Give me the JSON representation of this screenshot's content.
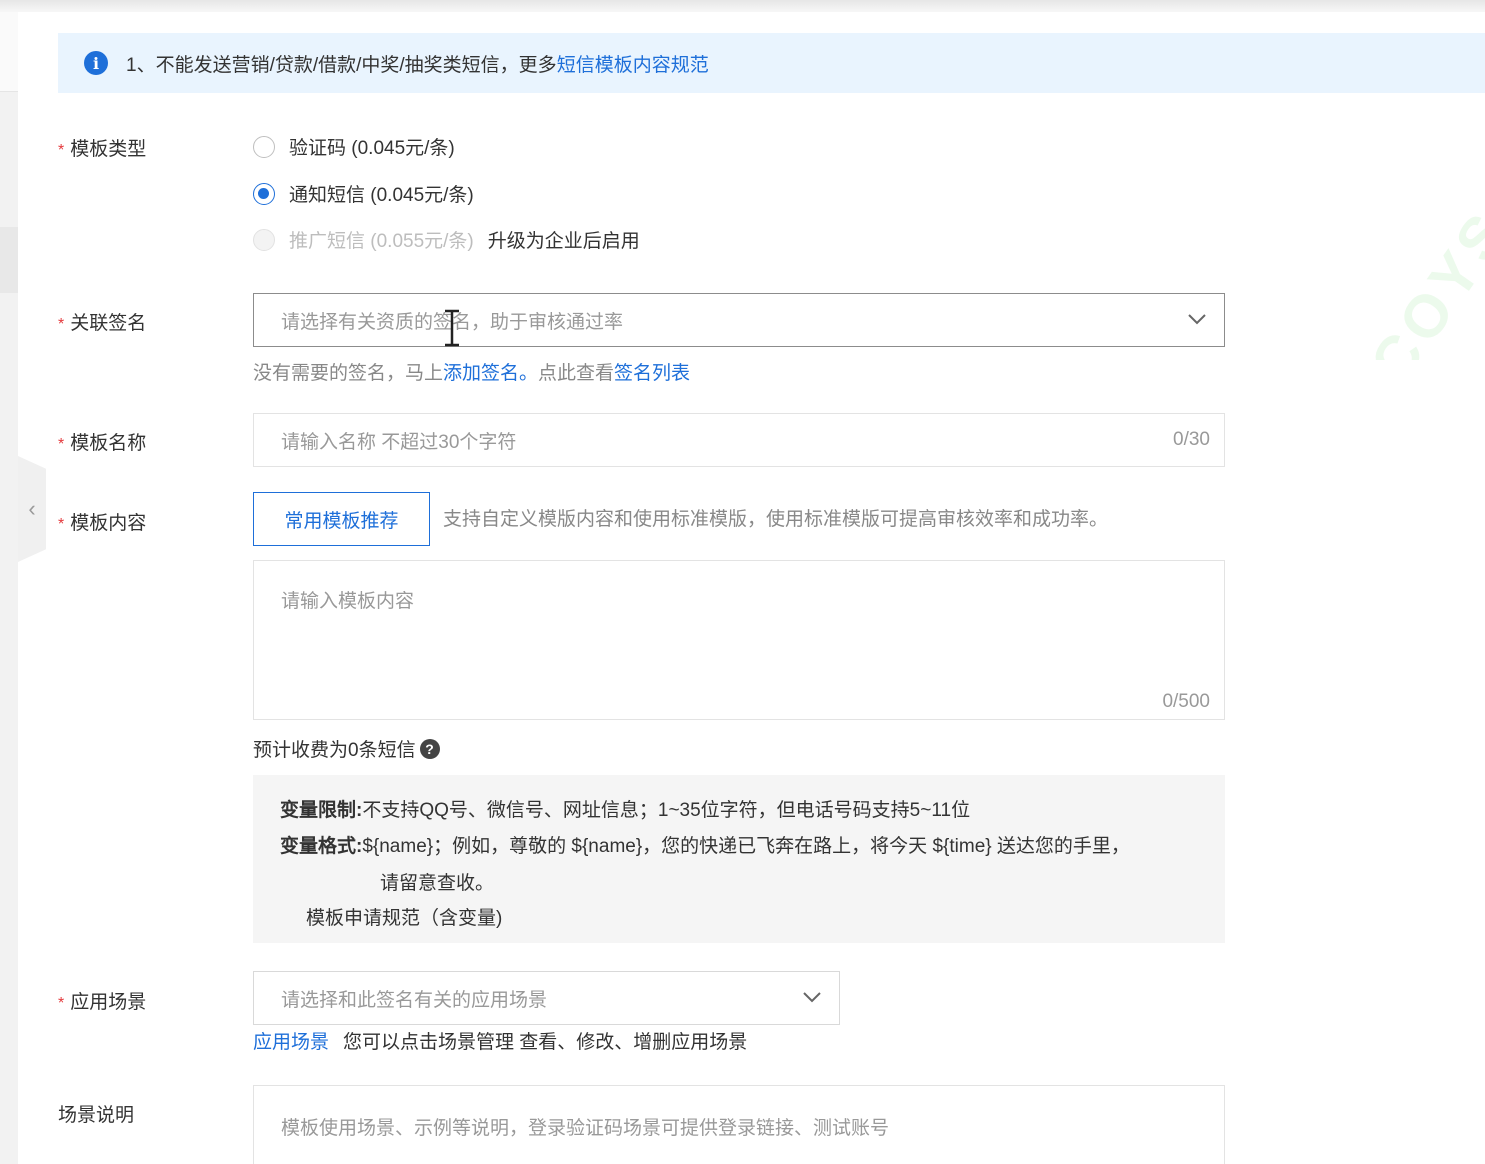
{
  "notice": {
    "icon": "info-icon",
    "text": "1、不能发送营销/贷款/借款/中奖/抽奖类短信，更多",
    "link": "短信模板内容规范"
  },
  "template_type": {
    "required_mark": "*",
    "label": "模板类型",
    "options": [
      {
        "label": "验证码 (0.045元/条)",
        "checked": false,
        "disabled": false
      },
      {
        "label": "通知短信 (0.045元/条)",
        "checked": true,
        "disabled": false
      },
      {
        "label": "推广短信 (0.055元/条)",
        "checked": false,
        "disabled": true
      }
    ],
    "upgrade_note": "升级为企业后启用"
  },
  "signature": {
    "required_mark": "*",
    "label": "关联签名",
    "placeholder": "请选择有关资质的签名，助于审核通过率",
    "hint_prefix": "没有需要的签名，马上",
    "hint_link_add": "添加签名。",
    "hint_middle": "点此查看",
    "hint_link_list": "签名列表"
  },
  "template_name": {
    "required_mark": "*",
    "label": "模板名称",
    "placeholder": "请输入名称 不超过30个字符",
    "counter": "0/30"
  },
  "template_content": {
    "required_mark": "*",
    "label": "模板内容",
    "recommend_button": "常用模板推荐",
    "support_text": "支持自定义模版内容和使用标准模版，使用标准模版可提高审核效率和成功率。",
    "placeholder": "请输入模板内容",
    "counter": "0/500",
    "estimate": "预计收费为0条短信",
    "estimate_icon": "question-icon"
  },
  "rules": {
    "limit_label": "变量限制:",
    "limit_text": "不支持QQ号、微信号、网址信息；1~35位字符，但电话号码支持5~11位",
    "format_label": "变量格式:",
    "format_text": "${name}；例如，尊敬的 ${name}，您的快递已飞奔在路上，将今天 ${time} 送达您的手里，",
    "format_text_cont": "请留意查收。",
    "link": "模板申请规范（含变量)"
  },
  "scene": {
    "required_mark": "*",
    "label": "应用场景",
    "placeholder": "请选择和此签名有关的应用场景",
    "link": "应用场景",
    "note": "您可以点击场景管理 查看、修改、增删应用场景"
  },
  "scene_desc": {
    "label": "场景说明",
    "placeholder": "模板使用场景、示例等说明，登录验证码场景可提供登录链接、测试账号"
  },
  "colors": {
    "accent": "#1e6fd9",
    "required": "#e4393c",
    "notice_bg": "#e9f4fe"
  }
}
